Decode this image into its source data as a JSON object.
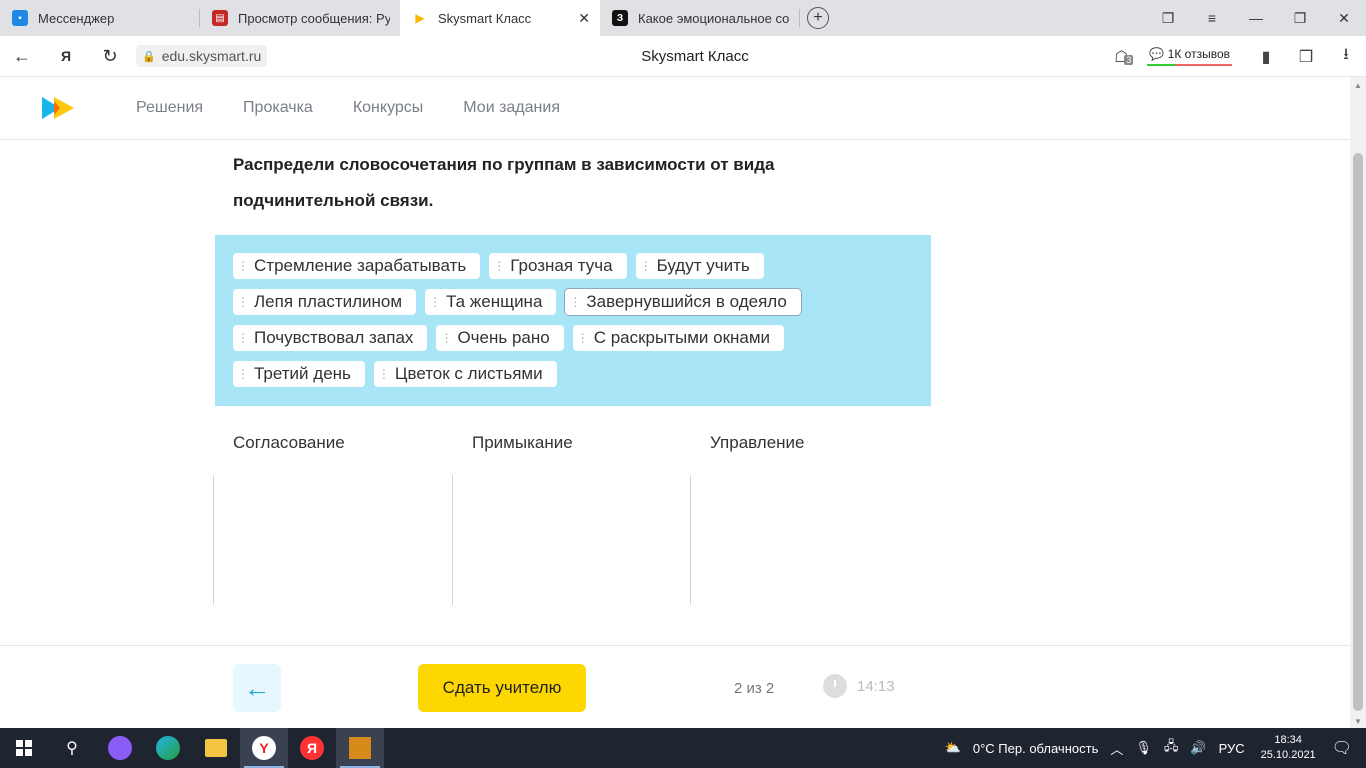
{
  "browser": {
    "tabs": [
      {
        "title": "Мессенджер",
        "favicon_color": "#1e88e5",
        "favicon_glyph": "▪",
        "active": false
      },
      {
        "title": "Просмотр сообщения: Ру",
        "favicon_color": "#c62828",
        "favicon_glyph": "▤",
        "active": false
      },
      {
        "title": "Skysmart Класс",
        "favicon_color": "#ffffff",
        "favicon_glyph": "▶",
        "active": true
      },
      {
        "title": "Какое эмоциональное со",
        "favicon_color": "#111111",
        "favicon_glyph": "З",
        "active": false
      }
    ],
    "close_glyph": "✕",
    "new_tab_glyph": "+",
    "url": "edu.skysmart.ru",
    "page_title": "Skysmart Класс",
    "reviews_label": "1К отзывов",
    "downloads_badge": "3",
    "window_controls": {
      "bookmarks": "❐",
      "menu": "≡",
      "minimize": "—",
      "restore": "❐",
      "close": "✕"
    },
    "nav": {
      "back": "←",
      "yandex": "Я",
      "reload": "↻"
    }
  },
  "site": {
    "nav_items": [
      "Решения",
      "Прокачка",
      "Конкурсы",
      "Мои задания"
    ]
  },
  "task": {
    "question": "Распредели словосочетания по группам в зависимости от вида подчинительной связи.",
    "grip_glyph": "⋮",
    "chip_rows": [
      [
        "Стремление зарабатывать",
        "Грозная туча",
        "Будут учить"
      ],
      [
        "Лепя пластилином",
        "Та женщина",
        "Завернувшийся в одеяло"
      ],
      [
        "Почувствовал запах",
        "Очень рано",
        "С раскрытыми окнами"
      ],
      [
        "Третий день",
        "Цветок с листьями"
      ]
    ],
    "columns": [
      "Согласование",
      "Примыкание",
      "Управление"
    ]
  },
  "footer": {
    "back_glyph": "←",
    "submit_label": "Сдать учителю",
    "progress": "2 из 2",
    "timer": "14:13"
  },
  "taskbar": {
    "weather": "0°C  Пер. облачность",
    "language": "РУС",
    "time": "18:34",
    "date": "25.10.2021"
  },
  "colors": {
    "bank_bg": "#a8e6f7",
    "submit_bg": "#ffd700",
    "accent_blue": "#1aa6d8"
  }
}
